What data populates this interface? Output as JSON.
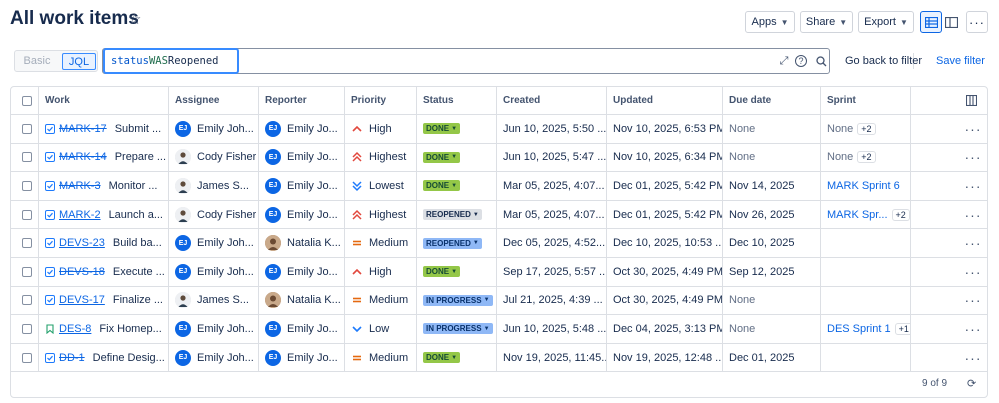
{
  "page": {
    "title": "All work items"
  },
  "toolbar": {
    "apps_label": "Apps",
    "share_label": "Share",
    "export_label": "Export"
  },
  "search": {
    "basic_label": "Basic",
    "jql_label": "JQL",
    "query_field": "status",
    "query_operator": "WAS",
    "query_value": "Reopened",
    "go_back_label": "Go back to filter",
    "save_label": "Save filter"
  },
  "table": {
    "columns": [
      "Work",
      "Assignee",
      "Reporter",
      "Priority",
      "Status",
      "Created",
      "Updated",
      "Due date",
      "Sprint"
    ],
    "rows": [
      {
        "type": "task",
        "key": "MARK-17",
        "key_done": true,
        "summary": "Submit ...",
        "assignee": "Emily Joh...",
        "assignee_av": "ej",
        "reporter": "Emily Jo...",
        "reporter_av": "ej",
        "priority": "High",
        "priority_icon": "high",
        "status": "DONE",
        "status_style": "done",
        "created": "Jun 10, 2025, 5:50 ...",
        "updated": "Nov 10, 2025, 6:53 PM",
        "due": "None",
        "due_muted": true,
        "sprint": "None",
        "sprint_link": false,
        "sprint_extra": "+2"
      },
      {
        "type": "task",
        "key": "MARK-14",
        "key_done": true,
        "summary": "Prepare ...",
        "assignee": "Cody Fisher",
        "assignee_av": "cf",
        "reporter": "Emily Jo...",
        "reporter_av": "ej",
        "priority": "Highest",
        "priority_icon": "highest",
        "status": "DONE",
        "status_style": "done",
        "created": "Jun 10, 2025, 5:47 ...",
        "updated": "Nov 10, 2025, 6:34 PM",
        "due": "None",
        "due_muted": true,
        "sprint": "None",
        "sprint_link": false,
        "sprint_extra": "+2"
      },
      {
        "type": "task",
        "key": "MARK-3",
        "key_done": true,
        "summary": "Monitor ...",
        "assignee": "James S...",
        "assignee_av": "js",
        "reporter": "Emily Jo...",
        "reporter_av": "ej",
        "priority": "Lowest",
        "priority_icon": "lowest",
        "status": "DONE",
        "status_style": "done",
        "created": "Mar 05, 2025, 4:07...",
        "updated": "Dec 01, 2025, 5:42 PM",
        "due": "Nov 14, 2025",
        "due_muted": false,
        "sprint": "MARK Sprint 6",
        "sprint_link": true,
        "sprint_extra": ""
      },
      {
        "type": "task",
        "key": "MARK-2",
        "key_done": false,
        "summary": "Launch a...",
        "assignee": "Cody Fisher",
        "assignee_av": "cf",
        "reporter": "Emily Jo...",
        "reporter_av": "ej",
        "priority": "Highest",
        "priority_icon": "highest",
        "status": "REOPENED",
        "status_style": "reopened",
        "created": "Mar 05, 2025, 4:07...",
        "updated": "Dec 01, 2025, 5:42 PM",
        "due": "Nov 26, 2025",
        "due_muted": false,
        "sprint": "MARK Spr...",
        "sprint_link": true,
        "sprint_extra": "+2"
      },
      {
        "type": "task",
        "key": "DEVS-23",
        "key_done": false,
        "summary": "Build ba...",
        "assignee": "Emily Joh...",
        "assignee_av": "ej",
        "reporter": "Natalia K...",
        "reporter_av": "nk",
        "priority": "Medium",
        "priority_icon": "medium",
        "status": "REOPENED",
        "status_style": "reopened-blue",
        "created": "Dec 05, 2025, 4:52...",
        "updated": "Dec 10, 2025, 10:53 ...",
        "due": "Dec 10, 2025",
        "due_muted": false,
        "sprint": "",
        "sprint_link": false,
        "sprint_extra": ""
      },
      {
        "type": "task",
        "key": "DEVS-18",
        "key_done": true,
        "summary": "Execute ...",
        "assignee": "Emily Joh...",
        "assignee_av": "ej",
        "reporter": "Emily Jo...",
        "reporter_av": "ej",
        "priority": "High",
        "priority_icon": "high",
        "status": "DONE",
        "status_style": "done",
        "created": "Sep 17, 2025, 5:57 ...",
        "updated": "Oct 30, 2025, 4:49 PM",
        "due": "Sep 12, 2025",
        "due_muted": false,
        "sprint": "",
        "sprint_link": false,
        "sprint_extra": ""
      },
      {
        "type": "task",
        "key": "DEVS-17",
        "key_done": false,
        "summary": "Finalize ...",
        "assignee": "James S...",
        "assignee_av": "js",
        "reporter": "Natalia K...",
        "reporter_av": "nk",
        "priority": "Medium",
        "priority_icon": "medium",
        "status": "IN PROGRESS",
        "status_style": "progress",
        "created": "Jul 21, 2025, 4:39 ...",
        "updated": "Oct 30, 2025, 4:49 PM",
        "due": "None",
        "due_muted": true,
        "sprint": "",
        "sprint_link": false,
        "sprint_extra": ""
      },
      {
        "type": "story",
        "key": "DES-8",
        "key_done": false,
        "summary": "Fix Homep...",
        "assignee": "Emily Joh...",
        "assignee_av": "ej",
        "reporter": "Emily Jo...",
        "reporter_av": "ej",
        "priority": "Low",
        "priority_icon": "low",
        "status": "IN PROGRESS",
        "status_style": "progress",
        "created": "Jun 10, 2025, 5:48 ...",
        "updated": "Dec 04, 2025, 3:13 PM",
        "due": "None",
        "due_muted": true,
        "sprint": "DES Sprint 1",
        "sprint_link": true,
        "sprint_extra": "+1"
      },
      {
        "type": "task",
        "key": "DD-1",
        "key_done": true,
        "summary": "Define Desig...",
        "assignee": "Emily Joh...",
        "assignee_av": "ej",
        "reporter": "Emily Jo...",
        "reporter_av": "ej",
        "priority": "Medium",
        "priority_icon": "medium",
        "status": "DONE",
        "status_style": "done",
        "created": "Nov 19, 2025, 11:45...",
        "updated": "Nov 19, 2025, 12:48 ...",
        "due": "Dec 01, 2025",
        "due_muted": false,
        "sprint": "",
        "sprint_link": false,
        "sprint_extra": ""
      }
    ]
  },
  "footer": {
    "count": "9 of 9"
  },
  "colors": {
    "accent": "#0c66e4",
    "done_lozenge": "#94c748",
    "progress_lozenge": "#8fb8f6",
    "priority_high": "#e2483d",
    "priority_low": "#1d7afc",
    "priority_medium": "#e56910"
  }
}
